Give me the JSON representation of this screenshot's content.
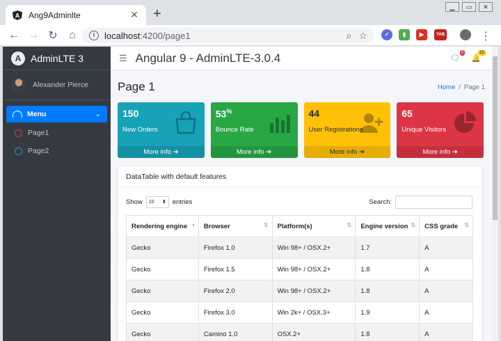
{
  "browser": {
    "tab_title": "Ang9Adminlte",
    "new_tab": "+",
    "url_host": "localhost",
    "url_rest": ":4200/page1",
    "ext_badge": "YAB"
  },
  "sidebar": {
    "brand": "AdminLTE 3",
    "brand_logo": "A",
    "user_name": "Alexander Pierce",
    "menu_label": "Menu",
    "items": [
      {
        "label": "Page1",
        "color": "#dc3545"
      },
      {
        "label": "Page2",
        "color": "#17a2b8"
      }
    ]
  },
  "navbar": {
    "title": "Angular 9 - AdminLTE-3.0.4",
    "messages_badge": "3",
    "notifications_badge": "15"
  },
  "header": {
    "page_title": "Page 1",
    "breadcrumb_home": "Home",
    "breadcrumb_sep": "/",
    "breadcrumb_current": "Page 1"
  },
  "boxes": [
    {
      "value": "150",
      "sup": "",
      "label": "New Orders",
      "footer": "More info",
      "color": "#17a2b8",
      "icon": "shopping-bag-icon"
    },
    {
      "value": "53",
      "sup": "%",
      "label": "Bounce Rate",
      "footer": "More info",
      "color": "#28a745",
      "icon": "bar-chart-icon"
    },
    {
      "value": "44",
      "sup": "",
      "label": "User Registrations",
      "footer": "More info",
      "color": "#ffc107",
      "icon": "user-plus-icon"
    },
    {
      "value": "65",
      "sup": "",
      "label": "Unique Visitors",
      "footer": "More info",
      "color": "#dc3545",
      "icon": "pie-chart-icon"
    }
  ],
  "card": {
    "title": "DataTable with default features",
    "show_label": "Show",
    "show_value": "10",
    "entries_label": "entries",
    "search_label": "Search:",
    "columns": [
      "Rendering engine",
      "Browser",
      "Platform(s)",
      "Engine version",
      "CSS grade"
    ],
    "rows": [
      [
        "Gecko",
        "Firefox 1.0",
        "Win 98+ / OSX.2+",
        "1.7",
        "A"
      ],
      [
        "Gecko",
        "Firefox 1.5",
        "Win 98+ / OSX.2+",
        "1.8",
        "A"
      ],
      [
        "Gecko",
        "Firefox 2.0",
        "Win 98+ / OSX.2+",
        "1.8",
        "A"
      ],
      [
        "Gecko",
        "Firefox 3.0",
        "Win 2k+ / OSX.3+",
        "1.9",
        "A"
      ],
      [
        "Gecko",
        "Camino 1.0",
        "OSX.2+",
        "1.8",
        "A"
      ]
    ]
  }
}
